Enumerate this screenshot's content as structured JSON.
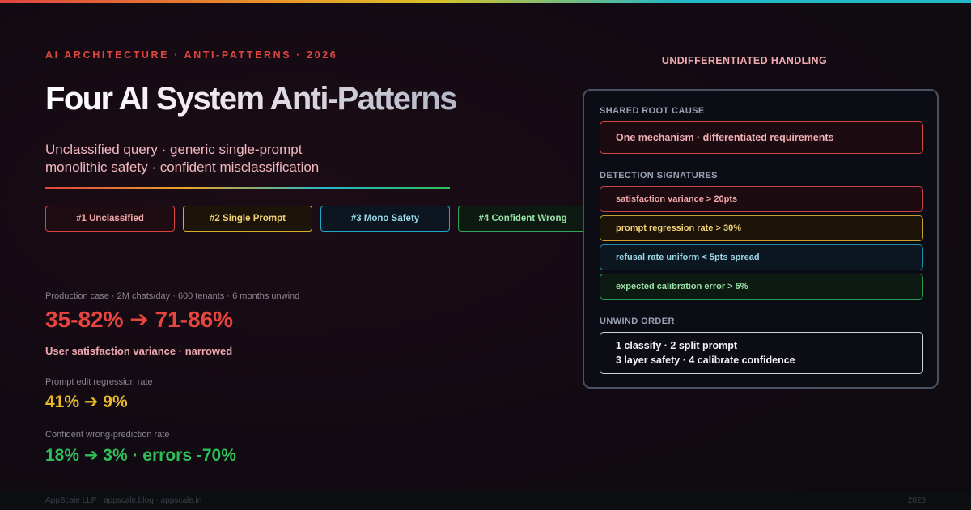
{
  "header": {
    "kicker": "AI ARCHITECTURE · ANTI-PATTERNS · 2026",
    "title": "Four AI System Anti-Patterns",
    "subtitle_line1": "Unclassified query · generic single-prompt",
    "subtitle_line2": "monolithic safety · confident misclassification"
  },
  "tags": [
    {
      "label": "#1 Unclassified",
      "color": "#d8443e"
    },
    {
      "label": "#2 Single Prompt",
      "color": "#d8ae2a"
    },
    {
      "label": "#3 Mono Safety",
      "color": "#22a8c8"
    },
    {
      "label": "#4 Confident Wrong",
      "color": "#2fa85a"
    }
  ],
  "stats": {
    "production_caption": "Production case · 2M chats/day · 600 tenants · 6 months unwind",
    "satisfaction_value": "35-82% ➔ 71-86%",
    "satisfaction_note": "User satisfaction variance · narrowed",
    "regression_caption": "Prompt edit regression rate",
    "regression_value": "41% ➔ 9%",
    "wrong_caption": "Confident wrong-prediction rate",
    "wrong_value": "18% ➔ 3% · errors -70%"
  },
  "panel": {
    "heading": "UNDIFFERENTIATED HANDLING",
    "root_label": "SHARED ROOT CAUSE",
    "root_text": "One mechanism · differentiated requirements",
    "detection_label": "DETECTION SIGNATURES",
    "signatures": [
      "satisfaction variance > 20pts",
      "prompt regression rate > 30%",
      "refusal rate uniform < 5pts spread",
      "expected calibration error > 5%"
    ],
    "unwind_label": "UNWIND ORDER",
    "unwind_line1": "1 classify · 2 split prompt",
    "unwind_line2": "3 layer safety · 4 calibrate confidence"
  },
  "footer": {
    "left": "AppScale LLP · appscale.blog · appscale.in",
    "right": "2026"
  },
  "colors": {
    "red": "#e8453f",
    "yellow": "#e8b82a",
    "cyan": "#22b8c8",
    "green": "#2fbf5a"
  }
}
